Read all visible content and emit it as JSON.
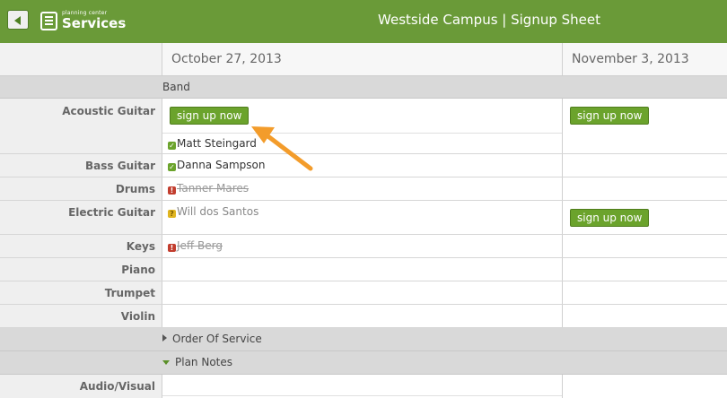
{
  "header": {
    "back_label": "back",
    "logo_small": "planning center",
    "logo_big": "Services",
    "title": "Westside Campus | Signup Sheet"
  },
  "dates": [
    "October 27, 2013",
    "November 3, 2013"
  ],
  "sections": {
    "band": "Band",
    "order_of_service": "Order Of Service",
    "plan_notes": "Plan Notes"
  },
  "signup_label": "sign up now",
  "positions": {
    "acoustic_guitar": "Acoustic Guitar",
    "bass_guitar": "Bass Guitar",
    "drums": "Drums",
    "electric_guitar": "Electric Guitar",
    "keys": "Keys",
    "piano": "Piano",
    "trumpet": "Trumpet",
    "violin": "Violin",
    "audio_visual": "Audio/Visual"
  },
  "people": {
    "acoustic": {
      "name": "Matt Steingard",
      "status": "confirmed"
    },
    "bass": {
      "name": "Danna Sampson",
      "status": "confirmed"
    },
    "drums": {
      "name": "Tanner Mares",
      "status": "declined"
    },
    "electric": {
      "name": "Will dos Santos",
      "status": "unconfirmed"
    },
    "keys": {
      "name": "Jeff Berg",
      "status": "declined"
    }
  },
  "colors": {
    "header": "#6a9a38",
    "button": "#6ba32c",
    "arrow": "#f39c2b"
  }
}
